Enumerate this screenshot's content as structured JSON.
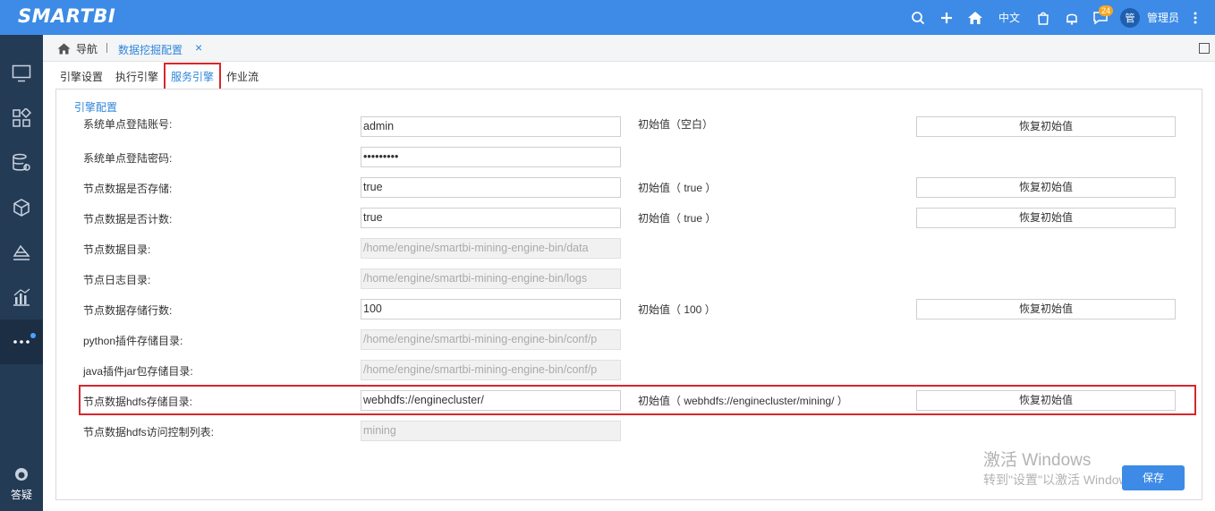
{
  "app": {
    "logo": "SMARTBI",
    "language": "中文",
    "notification_count": "24",
    "user_avatar": "管",
    "user_name": "管理员"
  },
  "breadcrumb": {
    "home": "导航",
    "tab": "数据挖掘配置",
    "close": "×"
  },
  "tabs": [
    {
      "label": "引擎设置"
    },
    {
      "label": "执行引擎"
    },
    {
      "label": "服务引擎",
      "active": true
    },
    {
      "label": "作业流"
    }
  ],
  "section_title": "引擎配置",
  "rows": [
    {
      "label": "系统单点登陆账号:",
      "value": "admin",
      "initial": "初始值（空白）",
      "reset": "恢复初始值"
    },
    {
      "label": "系统单点登陆密码:",
      "value": "•••••••••",
      "initial": "",
      "reset": ""
    },
    {
      "label": "节点数据是否存储:",
      "value": "true",
      "initial": "初始值（ true ）",
      "reset": "恢复初始值"
    },
    {
      "label": "节点数据是否计数:",
      "value": "true",
      "initial": "初始值（ true ）",
      "reset": "恢复初始值"
    },
    {
      "label": "节点数据目录:",
      "value": "/home/engine/smartbi-mining-engine-bin/data",
      "initial": "",
      "reset": ""
    },
    {
      "label": "节点日志目录:",
      "value": "/home/engine/smartbi-mining-engine-bin/logs",
      "initial": "",
      "reset": ""
    },
    {
      "label": "节点数据存储行数:",
      "value": "100",
      "initial": "初始值（ 100 ）",
      "reset": "恢复初始值"
    },
    {
      "label": "python插件存储目录:",
      "value": "/home/engine/smartbi-mining-engine-bin/conf/p",
      "initial": "",
      "reset": ""
    },
    {
      "label": "java插件jar包存储目录:",
      "value": "/home/engine/smartbi-mining-engine-bin/conf/p",
      "initial": "",
      "reset": ""
    },
    {
      "label": "节点数据hdfs存储目录:",
      "value": "webhdfs://enginecluster/",
      "initial": "初始值（ webhdfs://enginecluster/mining/ ）",
      "reset": "恢复初始值"
    },
    {
      "label": "节点数据hdfs访问控制列表:",
      "value": "mining",
      "initial": "",
      "reset": ""
    }
  ],
  "watermark": {
    "line1": "激活 Windows",
    "line2": "转到\"设置\"以激活 Windows。"
  },
  "save_label": "保存",
  "help_label": "答疑",
  "colors": {
    "topbar": "#3d8be6",
    "sidebar": "#243b56",
    "accent": "#2f86db",
    "highlight": "#d9262c"
  }
}
